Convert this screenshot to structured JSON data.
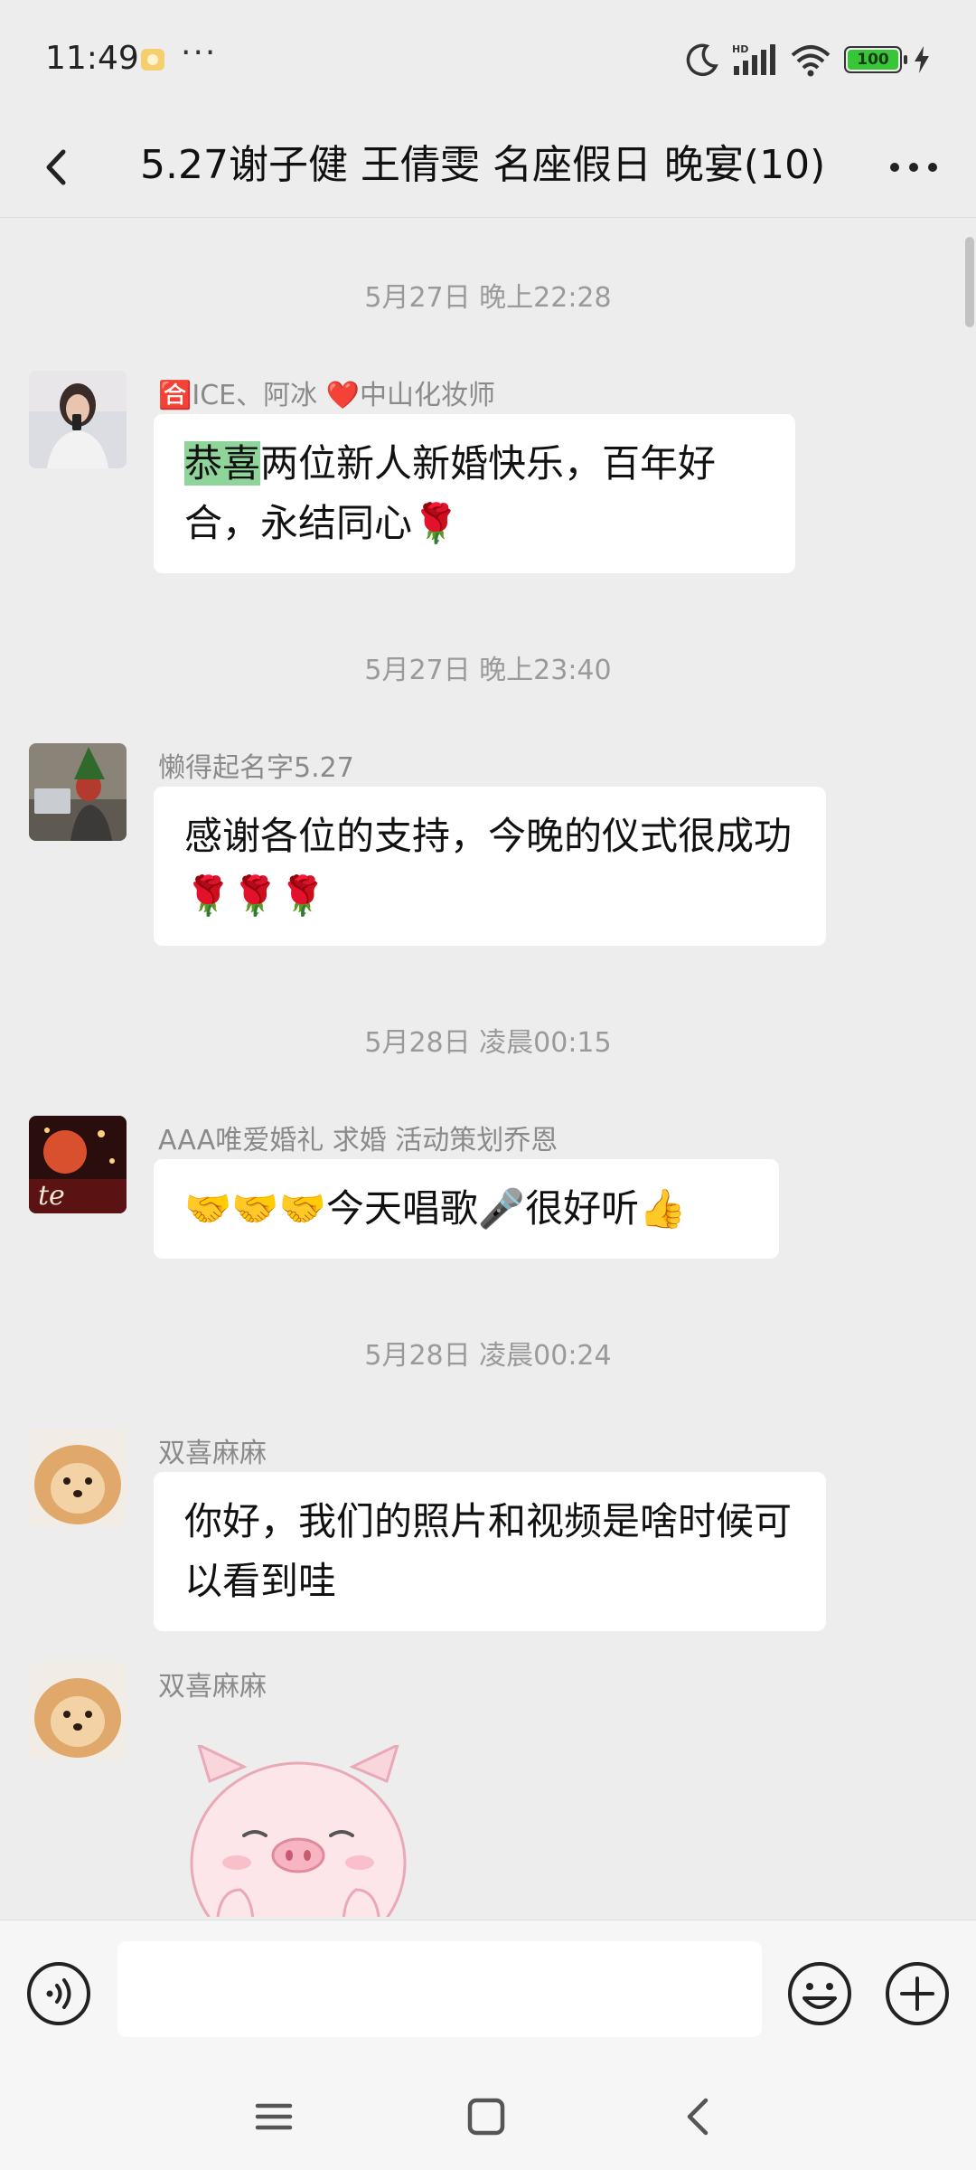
{
  "status_bar": {
    "time": "11:49",
    "dots": "···",
    "network_badge": "HD",
    "battery": "100"
  },
  "header": {
    "title": "5.27谢子健 王倩雯 名座假日 晚宴(10)",
    "back_icon": "chevron-left-icon",
    "more_icon": "more-horizontal-icon"
  },
  "messages": [
    {
      "timestamp": "5月27日 晚上22:28",
      "sender": "🈴ICE、阿冰 ❤️中山化妆师",
      "highlight": "恭喜",
      "text": "两位新人新婚快乐，百年好合，永结同心🌹"
    },
    {
      "timestamp": "5月27日 晚上23:40",
      "sender": "懒得起名字5.27",
      "text": "感谢各位的支持，今晚的仪式很成功🌹🌹🌹"
    },
    {
      "timestamp": "5月28日 凌晨00:15",
      "sender": "AAA唯爱婚礼 求婚 活动策划乔恩",
      "text": "🤝🤝🤝今天唱歌🎤很好听👍"
    },
    {
      "timestamp": "5月28日 凌晨00:24",
      "sender": "双喜麻麻",
      "text": "你好，我们的照片和视频是啥时候可以看到哇"
    },
    {
      "sender": "双喜麻麻",
      "sticker": "pig-sticker"
    }
  ],
  "input_bar": {
    "placeholder": "",
    "voice_icon": "voice-icon",
    "emoji_icon": "emoji-icon",
    "plus_icon": "plus-icon"
  },
  "nav_bar": {
    "icons": [
      "menu-icon",
      "home-square-icon",
      "back-triangle-icon"
    ]
  },
  "colors": {
    "background": "#ededed",
    "bubble": "#ffffff",
    "highlight": "#8fd49a",
    "battery": "#38c538"
  }
}
